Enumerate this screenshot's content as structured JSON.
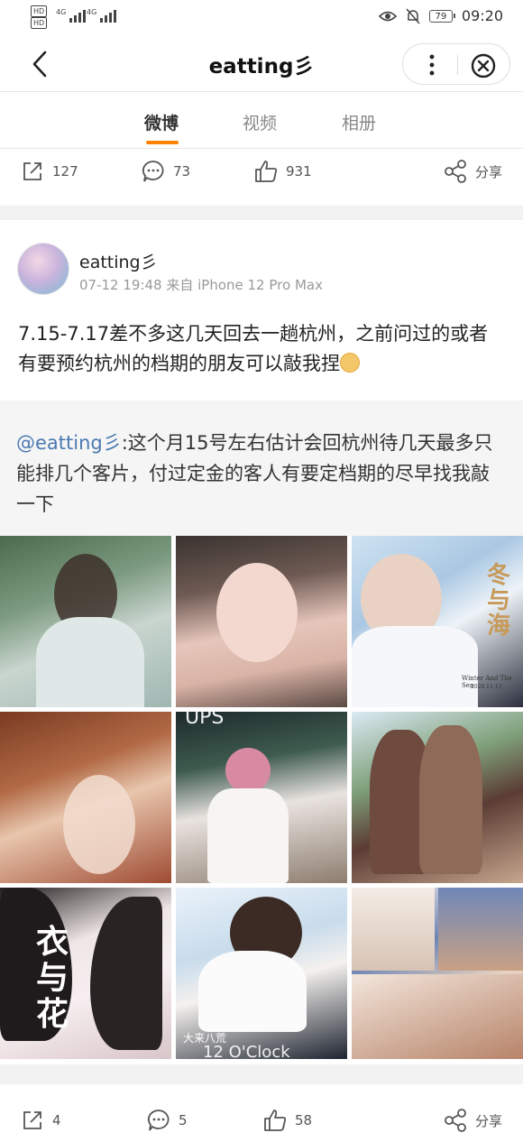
{
  "status_bar": {
    "hd1": "HD",
    "hd2": "HD",
    "net1": "4G",
    "net2": "4G",
    "battery": "79",
    "time": "09:20",
    "icons": [
      "eye-icon",
      "bell-off-icon"
    ]
  },
  "nav": {
    "title": "eatting彡"
  },
  "tabs": [
    {
      "label": "微博",
      "active": true
    },
    {
      "label": "视频",
      "active": false
    },
    {
      "label": "相册",
      "active": false
    }
  ],
  "prev_post_actions": {
    "repost": "127",
    "comment": "73",
    "like": "931",
    "share": "分享"
  },
  "post": {
    "author": "eatting彡",
    "meta": "07-12 19:48 来自 iPhone 12 Pro Max",
    "text": "7.15-7.17差不多这几天回去一趟杭州，之前问过的或者有要预约杭州的档期的朋友可以敲我捏",
    "repost": {
      "mention": "@eatting彡",
      "text": ":这个月15号左右估计会回杭州待几天最多只能排几个客片，付过定金的客人有要定档期的尽早找我敲一下"
    },
    "image_captions": {
      "photo3_title": "冬与海",
      "photo3_sub": "Winter And The Sea",
      "photo3_date": "2020.11.13",
      "photo5_text": "UPS",
      "photo7_title": "衣与花",
      "photo8_text": "大来八荒",
      "photo8_clock": "12 O'Clock"
    },
    "actions": {
      "repost": "4",
      "comment": "5",
      "like": "58",
      "share": "分享"
    }
  },
  "colors": {
    "accent": "#ff8200",
    "mention": "#4b79b2"
  }
}
